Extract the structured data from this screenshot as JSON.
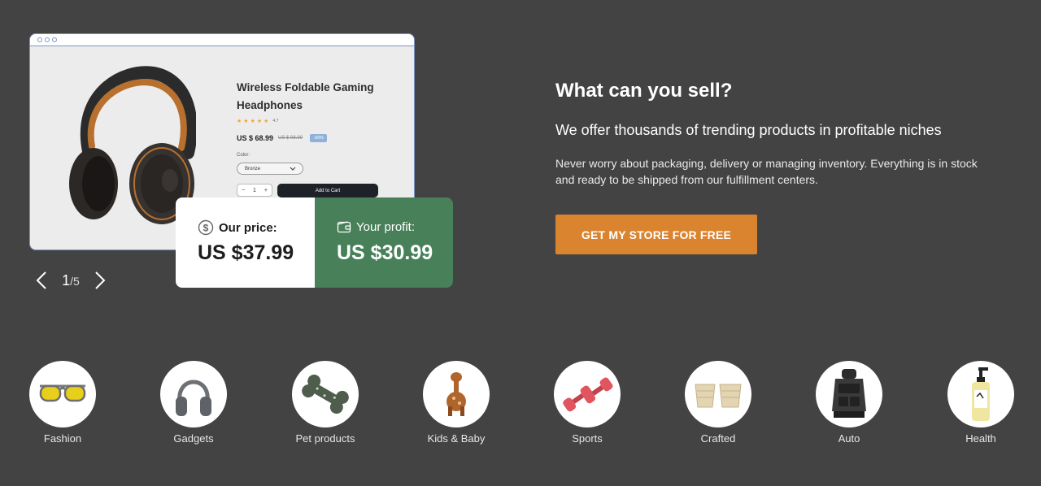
{
  "product": {
    "title": "Wireless Foldable Gaming Headphones",
    "rating": "4.7",
    "price": "US $ 68.99",
    "old_price": "US $ 98.99",
    "discount": "-30%",
    "color_label": "Color:",
    "color_value": "Bronze",
    "quantity": "1",
    "qty_minus": "−",
    "qty_plus": "+",
    "add_to_cart": "Add to Cart",
    "star_glyph": "★"
  },
  "pricing": {
    "our_price_label": "Our price:",
    "our_price_value": "US $37.99",
    "profit_label": "Your profit:",
    "profit_value": "US $30.99"
  },
  "pager": {
    "current": "1",
    "total": "/5"
  },
  "hero": {
    "heading": "What can you sell?",
    "subheading": "We offer thousands of trending products in profitable niches",
    "description": "Never worry about packaging, delivery or managing inventory. Everything is in stock and ready to be shipped from our fulfillment centers.",
    "cta": "GET MY STORE FOR FREE"
  },
  "categories": [
    {
      "label": "Fashion",
      "icon": "sunglasses-icon"
    },
    {
      "label": "Gadgets",
      "icon": "headphones-icon"
    },
    {
      "label": "Pet products",
      "icon": "dog-bone-toy-icon"
    },
    {
      "label": "Kids & Baby",
      "icon": "giraffe-toy-icon"
    },
    {
      "label": "Sports",
      "icon": "dumbbells-icon"
    },
    {
      "label": "Crafted",
      "icon": "woven-baskets-icon"
    },
    {
      "label": "Auto",
      "icon": "car-seat-organizer-icon"
    },
    {
      "label": "Health",
      "icon": "pump-bottle-icon"
    }
  ],
  "colors": {
    "background": "#434343",
    "cta": "#db8430",
    "profit": "#478059",
    "card": "#ffffff"
  }
}
